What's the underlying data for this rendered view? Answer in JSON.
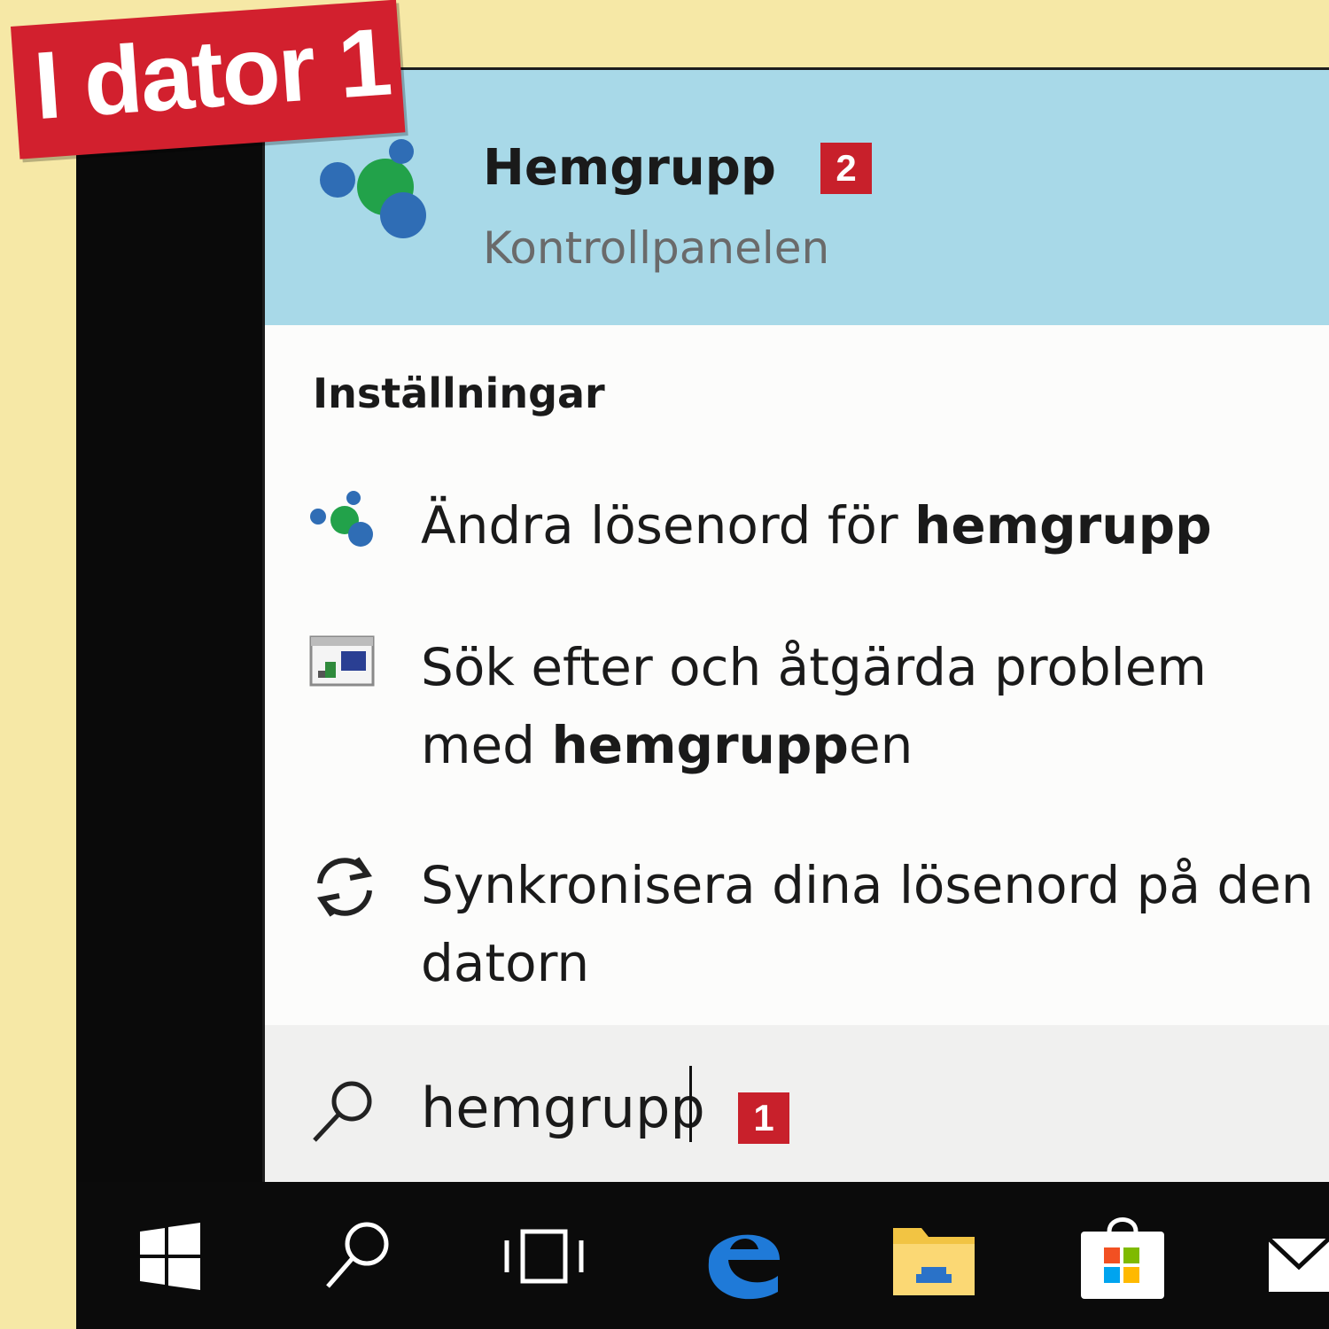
{
  "corner_label": "I dator 1",
  "top_result": {
    "title": "Hemgrupp",
    "subtitle": "Kontrollpanelen",
    "badge": "2",
    "icon": "homegroup-icon"
  },
  "section": {
    "title": "Inställningar"
  },
  "results": [
    {
      "text_plain": "Ändra lösenord för ",
      "text_bold": "hemgrupp",
      "icon": "homegroup-icon"
    },
    {
      "text_plain_1": "Sök efter och åtgärda problem",
      "text_plain_2": "med ",
      "text_bold": "hemgrupp",
      "text_plain_3": "en",
      "icon": "troubleshoot-window-icon"
    },
    {
      "text_plain_1": "Synkronisera dina lösenord på den",
      "text_plain_2": "datorn",
      "icon": "sync-icon"
    }
  ],
  "search": {
    "value": "hemgrupp",
    "badge": "1",
    "icon": "search-icon"
  },
  "taskbar": {
    "items": [
      "windows-start-icon",
      "search-icon",
      "task-view-icon",
      "edge-icon",
      "file-explorer-icon",
      "store-icon",
      "mail-icon"
    ]
  },
  "colors": {
    "highlight": "#a8d9e8",
    "badge": "#c8202b",
    "background": "#f6e8a6"
  }
}
